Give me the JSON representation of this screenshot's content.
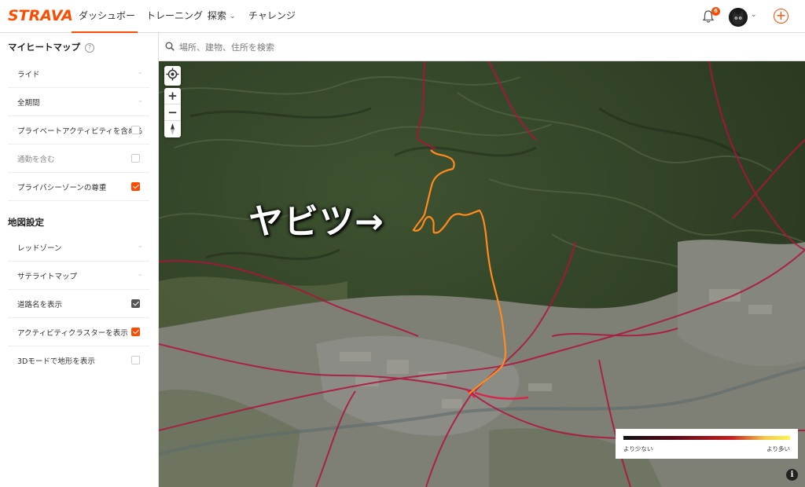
{
  "brand": {
    "logo": "STRAVA",
    "accent": "#fc4c02"
  },
  "nav": {
    "items": [
      {
        "label": "ダッシュボード",
        "has_dropdown": true,
        "active": true
      },
      {
        "label": "トレーニング",
        "has_dropdown": true
      },
      {
        "label": "探索",
        "has_dropdown": true
      },
      {
        "label": "チャレンジ",
        "has_dropdown": false
      }
    ],
    "notification_count": "6",
    "add_icon": "plus-circle-icon"
  },
  "sidebar": {
    "heatmap_title": "マイヒートマップ",
    "heatmap_rows": [
      {
        "label": "ライド",
        "type": "dropdown"
      },
      {
        "label": "全期間",
        "type": "dropdown"
      },
      {
        "label": "プライベートアクティビティを含める",
        "type": "checkbox",
        "checked": false
      },
      {
        "label": "通勤を含む",
        "type": "checkbox",
        "checked": false,
        "muted": true
      },
      {
        "label": "プライバシーゾーンの尊重",
        "type": "checkbox",
        "checked": true
      }
    ],
    "map_title": "地図設定",
    "map_rows": [
      {
        "label": "レッドゾーン",
        "type": "dropdown"
      },
      {
        "label": "サテライトマップ",
        "type": "dropdown"
      },
      {
        "label": "道路名を表示",
        "type": "checkbox",
        "checked": true,
        "style": "dark"
      },
      {
        "label": "アクティビティクラスターを表示",
        "type": "checkbox",
        "checked": true
      },
      {
        "label": "3Dモードで地形を表示",
        "type": "checkbox",
        "checked": false
      }
    ]
  },
  "search": {
    "placeholder": "場所、建物、住所を検索",
    "value": ""
  },
  "map": {
    "annotation": "ヤビツ→",
    "legend": {
      "low": "より少ない",
      "high": "より多い"
    },
    "controls": [
      "locate-icon",
      "zoom-in",
      "zoom-out",
      "compass-icon"
    ],
    "zoom_in_label": "+",
    "zoom_out_label": "−",
    "info_label": "i"
  }
}
